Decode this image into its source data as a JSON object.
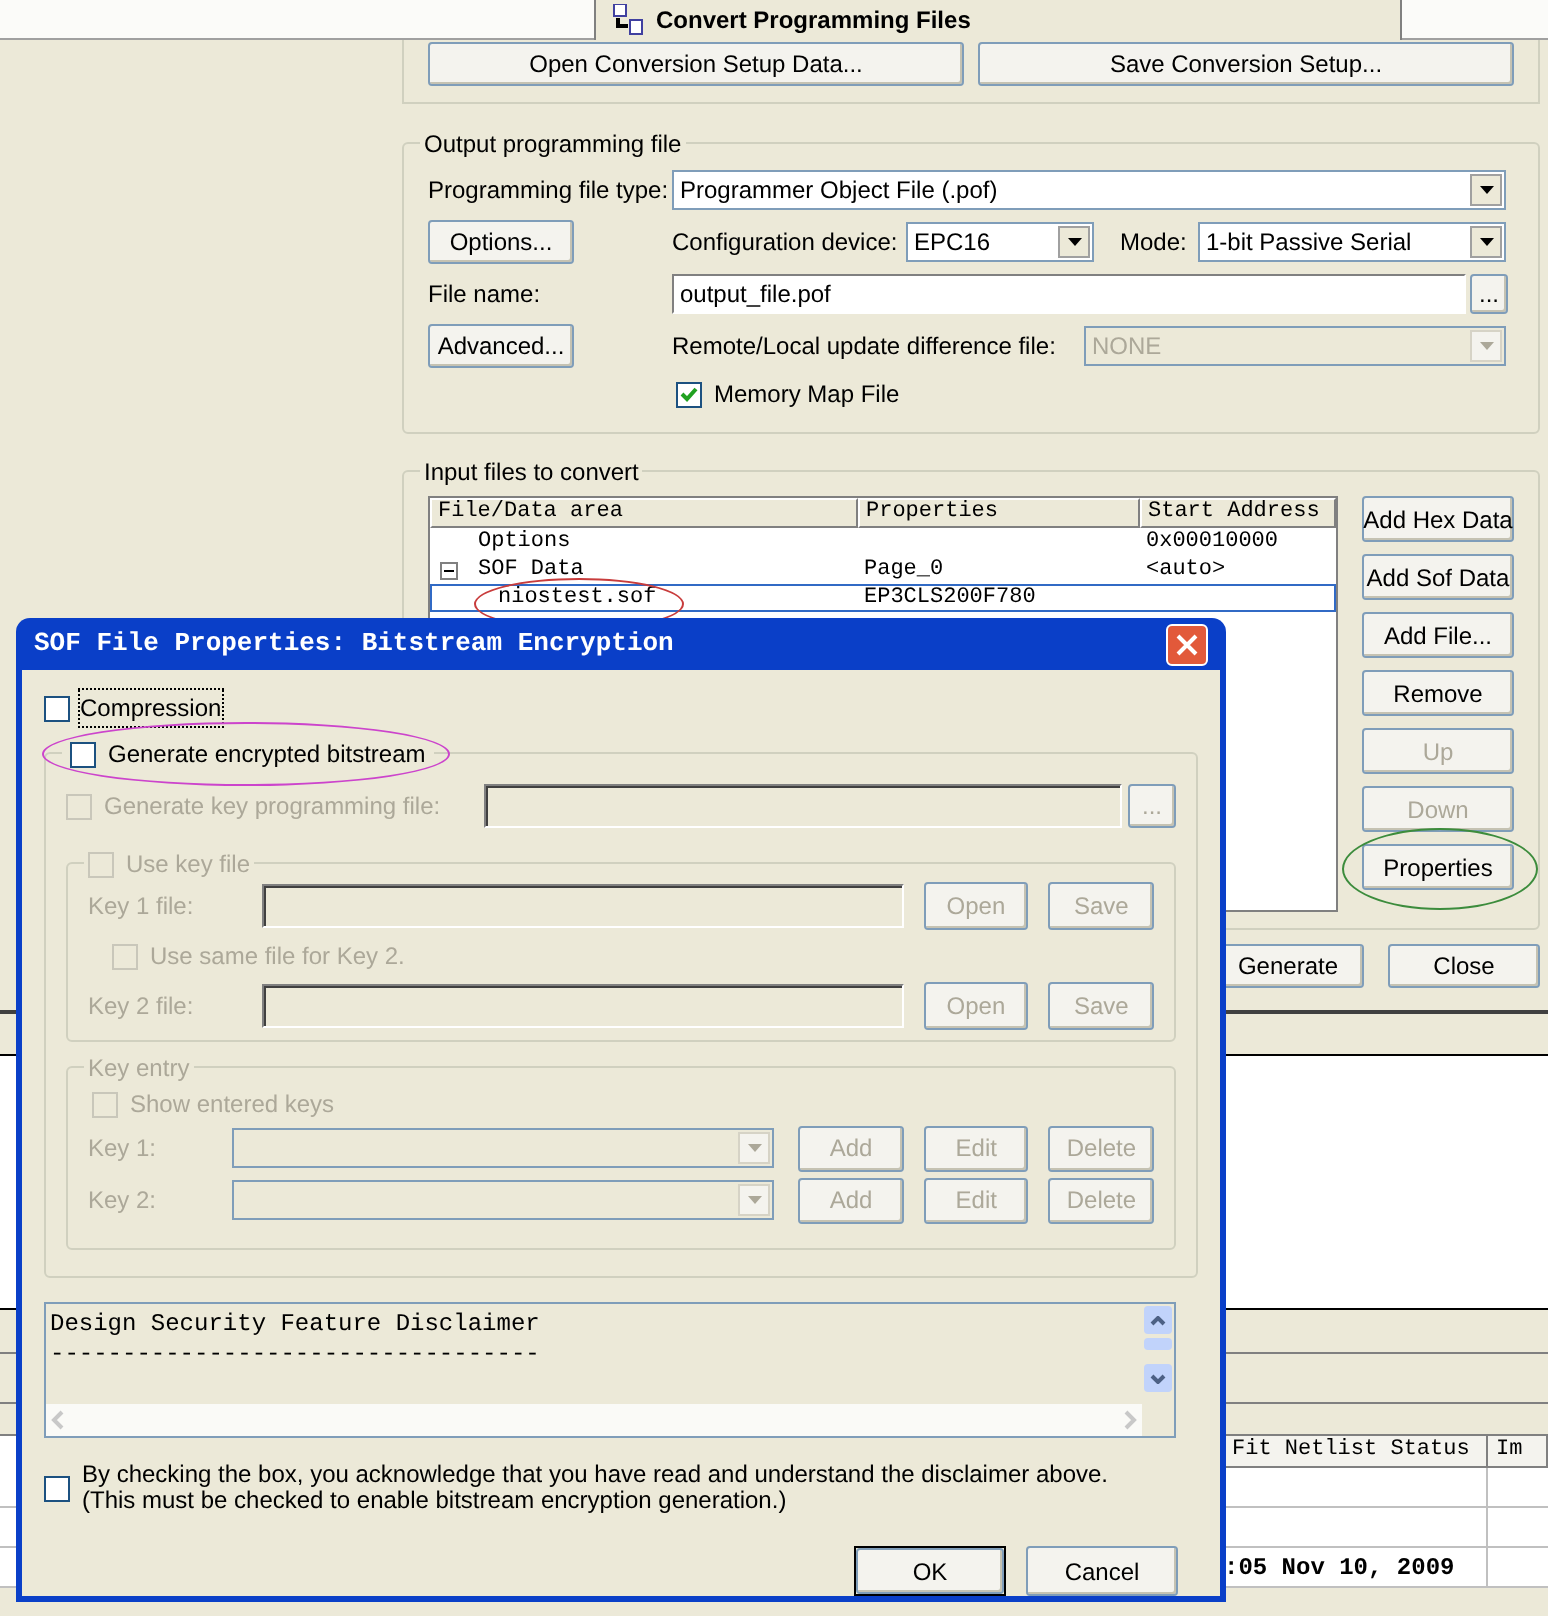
{
  "tab": {
    "title": "Convert Programming Files"
  },
  "setup_buttons": [
    {
      "label": "Open Conversion Setup Data..."
    },
    {
      "label": "Save Conversion Setup..."
    }
  ],
  "output": {
    "title": "Output programming file",
    "file_type_label": "Programming file type:",
    "file_type": "Programmer Object File (.pof)",
    "options_button": "Options...",
    "device_label": "Configuration device:",
    "device": "EPC16",
    "mode_label": "Mode:",
    "mode": "1-bit Passive Serial",
    "file_name_label": "File name:",
    "file_name": "output_file.pof",
    "browse_button": "...",
    "advanced_button": "Advanced...",
    "remote_label": "Remote/Local update difference file:",
    "remote": {
      "value": "NONE",
      "disabled": true
    },
    "memory_map": {
      "label": "Memory Map File",
      "checked": true
    }
  },
  "input": {
    "title": "Input files to convert",
    "columns": [
      "File/Data area",
      "Properties",
      "Start Address"
    ],
    "rows": [
      {
        "name": "Options",
        "start_address": "0x00010000",
        "selected": false
      },
      {
        "name": "SOF Data",
        "properties": "Page_0",
        "start_address": "<auto>",
        "selected": false,
        "expanded": true,
        "children": [
          {
            "name": "niostest.sof",
            "properties": "EP3CLS200F780",
            "selected": true,
            "color": "#c83c3c"
          }
        ]
      }
    ],
    "buttons": [
      {
        "label": "Add Hex Data",
        "disabled": false
      },
      {
        "label": "Add Sof Data",
        "disabled": false
      },
      {
        "label": "Add File...",
        "disabled": false
      },
      {
        "label": "Remove",
        "disabled": false
      },
      {
        "label": "Up",
        "disabled": true
      },
      {
        "label": "Down",
        "disabled": true
      },
      {
        "label": "Properties",
        "disabled": false,
        "color": "#3c8c3c"
      }
    ]
  },
  "actions": [
    {
      "label": "Generate"
    },
    {
      "label": "Close"
    }
  ],
  "status_table": {
    "columns": [
      "Fit Netlist Status",
      "Im"
    ],
    "rows": [
      {},
      {},
      {
        "status": ":05 Nov 10, 2009"
      }
    ]
  },
  "dialog": {
    "title": "SOF File Properties: Bitstream Encryption",
    "compression": {
      "label": "Compression",
      "checked": false
    },
    "encrypt": {
      "label": "Generate encrypted bitstream",
      "checked": false,
      "color": "#cc44cc"
    },
    "key_prog": {
      "label": "Generate key programming file:",
      "checked": false,
      "disabled": true,
      "browse": "..."
    },
    "key_file": {
      "label": "Use key file",
      "checked": false,
      "disabled": true,
      "rows": [
        {
          "label": "Key 1 file:",
          "buttons": [
            "Open",
            "Save"
          ]
        },
        {
          "label": "Key 2 file:",
          "buttons": [
            "Open",
            "Save"
          ]
        }
      ],
      "same_file": {
        "label": "Use same file for Key 2.",
        "checked": false
      }
    },
    "key_entry": {
      "title": "Key entry",
      "disabled": true,
      "show_keys": {
        "label": "Show entered keys",
        "checked": false
      },
      "rows": [
        {
          "label": "Key 1:",
          "buttons": [
            "Add",
            "Edit",
            "Delete"
          ]
        },
        {
          "label": "Key 2:",
          "buttons": [
            "Add",
            "Edit",
            "Delete"
          ]
        }
      ]
    },
    "disclaimer": {
      "lines": [
        "Design Security Feature Disclaimer",
        "----------------------------------"
      ]
    },
    "acknowledge": {
      "text": "By checking the box, you acknowledge that you have read and understand the disclaimer above. (This must be checked to enable bitstream encryption generation.)",
      "checked": false
    },
    "buttons": [
      {
        "label": "OK",
        "default": true
      },
      {
        "label": "Cancel",
        "default": false
      }
    ]
  }
}
